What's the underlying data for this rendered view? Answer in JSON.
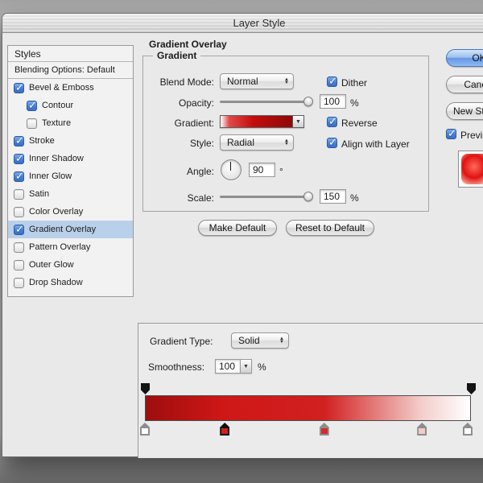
{
  "window": {
    "title": "Layer Style"
  },
  "styles_panel": {
    "header": "Styles",
    "blending_row": "Blending Options: Default",
    "items": [
      {
        "id": "bevel-emboss",
        "label": "Bevel & Emboss",
        "checked": true,
        "indent": false,
        "selected": false
      },
      {
        "id": "contour",
        "label": "Contour",
        "checked": true,
        "indent": true,
        "selected": false
      },
      {
        "id": "texture",
        "label": "Texture",
        "checked": false,
        "indent": true,
        "selected": false
      },
      {
        "id": "stroke",
        "label": "Stroke",
        "checked": true,
        "indent": false,
        "selected": false
      },
      {
        "id": "inner-shadow",
        "label": "Inner Shadow",
        "checked": true,
        "indent": false,
        "selected": false
      },
      {
        "id": "inner-glow",
        "label": "Inner Glow",
        "checked": true,
        "indent": false,
        "selected": false
      },
      {
        "id": "satin",
        "label": "Satin",
        "checked": false,
        "indent": false,
        "selected": false
      },
      {
        "id": "color-overlay",
        "label": "Color Overlay",
        "checked": false,
        "indent": false,
        "selected": false
      },
      {
        "id": "gradient-overlay",
        "label": "Gradient Overlay",
        "checked": true,
        "indent": false,
        "selected": true
      },
      {
        "id": "pattern-overlay",
        "label": "Pattern Overlay",
        "checked": false,
        "indent": false,
        "selected": false
      },
      {
        "id": "outer-glow",
        "label": "Outer Glow",
        "checked": false,
        "indent": false,
        "selected": false
      },
      {
        "id": "drop-shadow",
        "label": "Drop Shadow",
        "checked": false,
        "indent": false,
        "selected": false
      }
    ]
  },
  "main_panel": {
    "title": "Gradient Overlay",
    "group_label": "Gradient",
    "blend_mode_label": "Blend Mode:",
    "blend_mode_value": "Normal",
    "dither_label": "Dither",
    "dither_checked": true,
    "opacity_label": "Opacity:",
    "opacity_value": "100",
    "opacity_unit": "%",
    "gradient_label": "Gradient:",
    "reverse_label": "Reverse",
    "reverse_checked": true,
    "style_label": "Style:",
    "style_value": "Radial",
    "align_label": "Align with Layer",
    "align_checked": true,
    "angle_label": "Angle:",
    "angle_value": "90",
    "angle_unit": "°",
    "scale_label": "Scale:",
    "scale_value": "150",
    "scale_unit": "%",
    "make_default_label": "Make Default",
    "reset_default_label": "Reset to Default",
    "gradient_swatch": [
      {
        "pos": 0,
        "color": "#ffffff"
      },
      {
        "pos": 12,
        "color": "#e04a4a"
      },
      {
        "pos": 45,
        "color": "#c40d0d"
      },
      {
        "pos": 100,
        "color": "#8e0707"
      }
    ]
  },
  "right_panel": {
    "ok_label": "OK",
    "cancel_label": "Cancel",
    "new_style_label": "New Style...",
    "preview_label": "Preview",
    "preview_checked": true
  },
  "gradient_editor": {
    "type_label": "Gradient Type:",
    "type_value": "Solid",
    "smoothness_label": "Smoothness:",
    "smoothness_value": "100",
    "smoothness_unit": "%",
    "bar_gradient": [
      {
        "pos": 0,
        "color": "#9e0d0d"
      },
      {
        "pos": 24,
        "color": "#cf1717"
      },
      {
        "pos": 55,
        "color": "#d12020"
      },
      {
        "pos": 85,
        "color": "#f3cecb"
      },
      {
        "pos": 100,
        "color": "#ffffff"
      }
    ],
    "color_stops": [
      {
        "pos": 0,
        "color": "#ffffff",
        "selected": false
      },
      {
        "pos": 24.5,
        "color": "#d41f1f",
        "selected": true
      },
      {
        "pos": 55,
        "color": "#d42a2a",
        "selected": false
      },
      {
        "pos": 85,
        "color": "#f2cbc8",
        "selected": false
      },
      {
        "pos": 99,
        "color": "#ffffff",
        "selected": false
      }
    ],
    "opacity_stops": [
      {
        "pos": 0
      },
      {
        "pos": 100
      }
    ]
  },
  "colors": {
    "selection_highlight": "#b9d0ea",
    "checkbox_blue": "#4a82d8",
    "ok_button_blue": "#6497e2"
  }
}
